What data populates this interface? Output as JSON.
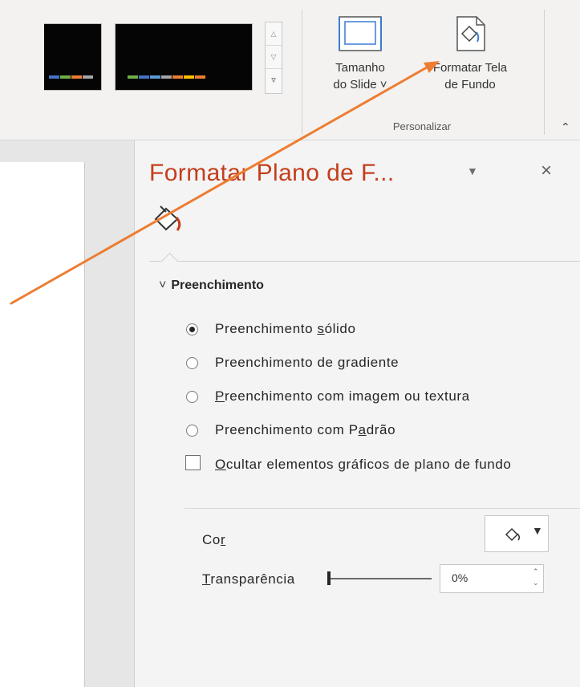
{
  "ribbon": {
    "theme_swatch_colors": [
      [
        "#4472c4",
        "#70ad47",
        "#ed7d31",
        "#a5a5a5"
      ],
      [
        "#70ad47",
        "#4472c4",
        "#5b9bd5",
        "#a5a5a5",
        "#ed7d31",
        "#ffc000",
        "#ed7d31"
      ]
    ],
    "gallery_scroll": {
      "up_icon": "chevron-up-icon",
      "down_icon": "chevron-down-icon",
      "more_icon": "gallery-more-icon"
    },
    "slide_size": {
      "line1": "Tamanho",
      "line2": "do Slide ˅",
      "icon": "slide-size-icon"
    },
    "format_background": {
      "line1": "Formatar Tela",
      "line2": "de Fundo",
      "icon": "format-background-icon"
    },
    "group_label": "Personalizar",
    "collapse_icon": "chevron-up-icon"
  },
  "pane": {
    "title": "Formatar Plano de F...",
    "options_icon": "dropdown-arrow-icon",
    "close_symbol": "×",
    "fill_tab_icon": "paint-bucket-icon",
    "section": {
      "chevron": "˅",
      "title": "Preenchimento"
    },
    "fill_options": [
      {
        "pre": "Preenchimento ",
        "acc": "s",
        "post": "ólido",
        "selected": true
      },
      {
        "pre": "Preenchimento de ",
        "acc": "g",
        "post": "radiente",
        "selected": false
      },
      {
        "pre": "",
        "acc": "P",
        "post": "reenchimento com imagem ou textura",
        "selected": false
      },
      {
        "pre": "Preenchimento com P",
        "acc": "a",
        "post": "drão",
        "selected": false
      }
    ],
    "hide_graphics": {
      "acc": "O",
      "post": "cultar elementos gráficos de plano de fundo",
      "checked": false
    },
    "color": {
      "pre": "Co",
      "acc": "r",
      "post": ""
    },
    "transparency": {
      "acc": "T",
      "post": "ransparência",
      "value": "0%",
      "slider_fraction": 0
    }
  },
  "colors": {
    "accent_title": "#c43e1c",
    "annotation_arrow": "#ed7d31",
    "fill_icon_accent": "#c43e1c"
  }
}
